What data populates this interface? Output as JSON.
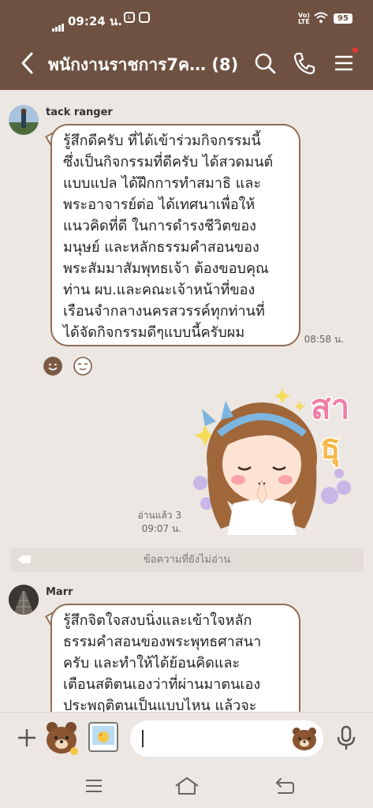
{
  "status_bar": {
    "time": "09:24 น.",
    "battery": "95",
    "network": "Vo) LTE"
  },
  "header": {
    "title": "พนักงานราชการ7ค…",
    "member_count": "(8)",
    "icons": [
      "back-icon",
      "search-icon",
      "phone-icon",
      "menu-icon"
    ],
    "colors": {
      "bar": "#6e5140",
      "notification_dot": "#e4362f"
    }
  },
  "messages": [
    {
      "sender": "tack ranger",
      "text": "รู้สึกดีครับ ที่ได้เข้าร่วมกิจกรรมนี้\nซึ่งเป็นกิจกรรมที่ดีครับ ได้สวดมนต์\nแบบแปล ได้ฝึกการทำสมาธิ  และ\nพระอาจารย์ต่อ ได้เทศนาเพื่อให้\nแนวคิดที่ดี ในการดำรงชีวิตของ\nมนุษย์ และหลักธรรมคำสอนของ\nพระสัมมาสัมพุทธเจ้า ต้องขอบคุณ\nท่าน ผบ.และคณะเจ้าหน้าที่ของ\nเรือนจำกลางนครสวรรค์ทุกท่านที่\nได้จัดกิจกรรมดีๆแบบนี้ครับผม",
      "time": "08:58 น.",
      "reactions": [
        "smile-reaction-icon",
        "blush-reaction-icon"
      ]
    },
    {
      "type": "sticker",
      "sticker_text": "สาธุ",
      "read_label": "อ่านแล้ว 3",
      "time": "09:07 น."
    },
    {
      "sender": "Marr",
      "text": "    รู้สึกจิตใจสงบนิ่งและเข้าใจหลัก\nธรรมคำสอนของพระพุทธศาสนา\nครับ และทำให้ได้ย้อนคิดและ\nเตือนสติตนเองว่าที่ผ่านมาตนเอง\nประพฤติตนเป็นแบบไหน แล้วจะ"
    }
  ],
  "unread_divider": "ข้อความที่ยังไม่อ่าน",
  "input_bar": {
    "icons": [
      "plus-icon",
      "brown-sticker-icon",
      "photo-icon",
      "brown-emoji-icon",
      "mic-icon"
    ]
  },
  "nav_bar": {
    "icons": [
      "recent-apps-icon",
      "home-icon",
      "back-nav-icon"
    ]
  }
}
